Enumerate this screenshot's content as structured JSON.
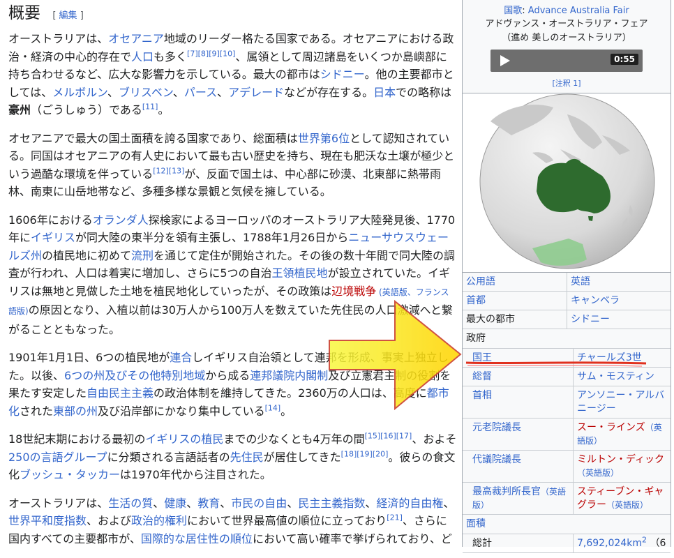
{
  "heading": {
    "title": "概要",
    "edit_open": "[",
    "edit_label": "編集",
    "edit_close": "]"
  },
  "paragraphs": [
    [
      {
        "t": "オーストラリアは、"
      },
      {
        "t": "オセアニア",
        "link": true
      },
      {
        "t": "地域のリーダー格たる国家である。オセアニアにおける政治・経済の中心的存在で"
      },
      {
        "t": "人口",
        "link": true
      },
      {
        "t": "も多く"
      },
      {
        "t": "[7][8][9][10]",
        "sup": true
      },
      {
        "t": "、属領として周辺諸島をいくつか島嶼部に持ち合わせるなど、広大な影響力を示している。最大の都市は"
      },
      {
        "t": "シドニー",
        "link": true
      },
      {
        "t": "。他の主要都市としては、"
      },
      {
        "t": "メルボルン",
        "link": true
      },
      {
        "t": "、"
      },
      {
        "t": "ブリスベン",
        "link": true
      },
      {
        "t": "、"
      },
      {
        "t": "パース",
        "link": true
      },
      {
        "t": "、"
      },
      {
        "t": "アデレード",
        "link": true
      },
      {
        "t": "などが存在する。"
      },
      {
        "t": "日本",
        "link": true
      },
      {
        "t": "での略称は"
      },
      {
        "t": "豪州",
        "bold": true
      },
      {
        "t": "（ごうしゅう）である"
      },
      {
        "t": "[11]",
        "sup": true
      },
      {
        "t": "。"
      }
    ],
    [
      {
        "t": "オセアニアで最大の国土面積を誇る国家であり、総面積は"
      },
      {
        "t": "世界第6位",
        "link": true
      },
      {
        "t": "として認知されている。同国はオセアニアの有人史において最も古い歴史を持ち、現在も肥沃な土壌が極少という過酷な環境を伴っている"
      },
      {
        "t": "[12][13]",
        "sup": true
      },
      {
        "t": "が、反面で国土は、中心部に砂漠、北東部に熱帯雨林、南東に山岳地帯など、多種多様な景観と気候を擁している。"
      }
    ],
    [
      {
        "t": "1606年における"
      },
      {
        "t": "オランダ人",
        "link": true
      },
      {
        "t": "探検家によるヨーロッパのオーストラリア大陸発見後、1770年に"
      },
      {
        "t": "イギリス",
        "link": true
      },
      {
        "t": "が同大陸の東半分を領有主張し、1788年1月26日から"
      },
      {
        "t": "ニューサウスウェールズ州",
        "link": true
      },
      {
        "t": "の植民地に初めて"
      },
      {
        "t": "流刑",
        "link": true
      },
      {
        "t": "を通じて定住が開始された。その後の数十年間で同大陸の調査が行われ、人口は着実に増加し、さらに5つの自治"
      },
      {
        "t": "王領植民地",
        "link": true
      },
      {
        "t": "が設立されていた。イギリスは無地と見做した土地を植民地化していったが、その政策は"
      },
      {
        "t": "辺境戦争",
        "red": true
      },
      {
        "t": " (英語版、フランス語版)",
        "small": true
      },
      {
        "t": "の原因となり、入植以前は30万人から100万人を数えていた先住民の人口激減へと繋がることともなった。"
      }
    ],
    [
      {
        "t": "1901年1月1日、6つの植民地が"
      },
      {
        "t": "連合",
        "link": true
      },
      {
        "t": "しイギリス自治領として連邦を形成、事実上独立した。以後、"
      },
      {
        "t": "6つの州及びその他特別地域",
        "link": true
      },
      {
        "t": "から成る"
      },
      {
        "t": "連邦議院内閣制",
        "link": true
      },
      {
        "t": "及び立憲君主制の役割を果たす安定した"
      },
      {
        "t": "自由民主主義",
        "link": true
      },
      {
        "t": "の政治体制を維持してきた。2360万の人口は、高度に"
      },
      {
        "t": "都市化",
        "link": true
      },
      {
        "t": "された"
      },
      {
        "t": "東部の州",
        "link": true
      },
      {
        "t": "及び沿岸部にかなり集中している"
      },
      {
        "t": "[14]",
        "sup": true
      },
      {
        "t": "。"
      }
    ],
    [
      {
        "t": "18世紀末期における最初の"
      },
      {
        "t": "イギリスの植民",
        "link": true
      },
      {
        "t": "までの少なくとも4万年の間"
      },
      {
        "t": "[15][16][17]",
        "sup": true
      },
      {
        "t": "、およそ"
      },
      {
        "t": "250の言語グループ",
        "link": true
      },
      {
        "t": "に分類される言語話者の"
      },
      {
        "t": "先住民",
        "link": true
      },
      {
        "t": "が居住してきた"
      },
      {
        "t": "[18][19][20]",
        "sup": true
      },
      {
        "t": "。彼らの食文化"
      },
      {
        "t": "ブッシュ・タッカー",
        "link": true
      },
      {
        "t": "は1970年代から注目された。"
      }
    ],
    [
      {
        "t": "オーストラリアは、"
      },
      {
        "t": "生活の質",
        "link": true
      },
      {
        "t": "、"
      },
      {
        "t": "健康",
        "link": true
      },
      {
        "t": "、"
      },
      {
        "t": "教育",
        "link": true
      },
      {
        "t": "、"
      },
      {
        "t": "市民の自由",
        "link": true
      },
      {
        "t": "、"
      },
      {
        "t": "民主主義指数",
        "link": true
      },
      {
        "t": "、"
      },
      {
        "t": "経済的自由権",
        "link": true
      },
      {
        "t": "、"
      },
      {
        "t": "世界平和度指数",
        "link": true
      },
      {
        "t": "、および"
      },
      {
        "t": "政治的権利",
        "link": true
      },
      {
        "t": "において世界最高値の順位に立っており"
      },
      {
        "t": "[21]",
        "sup": true
      },
      {
        "t": "、さらに国内すべての主要都市が、"
      },
      {
        "t": "国際的な居住性の順位",
        "link": true
      },
      {
        "t": "において高い確率で挙げられており、ど"
      }
    ]
  ],
  "infobox": {
    "anthem_label": "国歌",
    "anthem_sep": ":",
    "anthem_title": "Advance Australia Fair",
    "anthem_reading": "アドヴァンス・オーストラリア・フェア",
    "anthem_translation": "（進め 美しのオーストラリア）",
    "audio_time": "0:55",
    "note": "[注釈 1]",
    "rows": [
      {
        "label": "公用語",
        "value": "英語"
      },
      {
        "label": "首都",
        "value": "キャンベラ"
      },
      {
        "label": "最大の都市",
        "value": "シドニー",
        "label_plain": true
      }
    ],
    "gov_label": "政府",
    "gov_rows": [
      {
        "label": "国王",
        "value": "チャールズ3世"
      },
      {
        "label": "総督",
        "value": "サム・モスティン"
      },
      {
        "label": "首相",
        "value": "アンソニー・アルバニージー"
      },
      {
        "label": "元老院議長",
        "value": "スー・ラインズ",
        "value_red": true,
        "value_suffix": "（英語版）"
      },
      {
        "label": "代議院議長",
        "value": "ミルトン・ディック",
        "value_red": true,
        "value_suffix": "（英語版）"
      },
      {
        "label": "最高裁判所長官",
        "label_suffix": "（英語版）",
        "value": "スティーブン・ギャグラー",
        "value_red": true,
        "value_suffix": "（英語版）"
      }
    ],
    "area_label": "面積",
    "area_total_label": "総計",
    "area_total_value": "7,692,024km",
    "area_total_sup": "2",
    "area_total_rank": "（6"
  },
  "colors": {
    "link": "#3366cc",
    "redlink": "#ba0000",
    "land": "#2e6b2e",
    "arrow": "#f5f51e"
  }
}
